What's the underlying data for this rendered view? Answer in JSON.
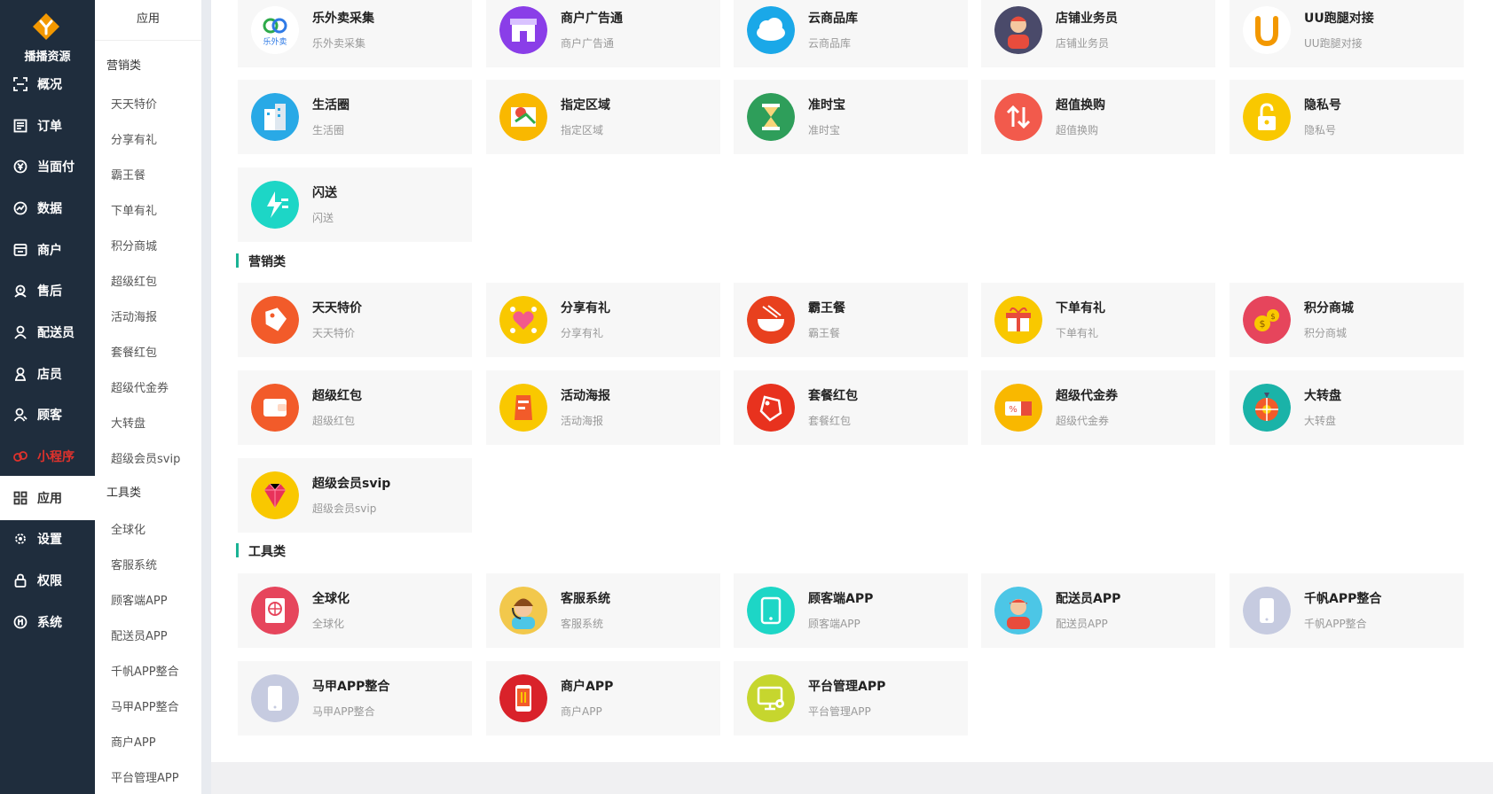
{
  "brand": {
    "name": "播播资源",
    "accent": "#f39800"
  },
  "sidebar": {
    "items": [
      {
        "label": "概况",
        "icon": "dashboard-icon"
      },
      {
        "label": "订单",
        "icon": "order-list-icon"
      },
      {
        "label": "当面付",
        "icon": "yuan-coin-icon"
      },
      {
        "label": "数据",
        "icon": "chart-icon"
      },
      {
        "label": "商户",
        "icon": "shop-icon"
      },
      {
        "label": "售后",
        "icon": "support-icon"
      },
      {
        "label": "配送员",
        "icon": "courier-icon"
      },
      {
        "label": "店员",
        "icon": "clerk-icon"
      },
      {
        "label": "顾客",
        "icon": "customer-icon"
      },
      {
        "label": "小程序",
        "icon": "mini-program-icon"
      },
      {
        "label": "应用",
        "icon": "apps-grid-icon"
      },
      {
        "label": "设置",
        "icon": "gear-icon"
      },
      {
        "label": "权限",
        "icon": "lock-icon"
      },
      {
        "label": "系统",
        "icon": "system-icon"
      }
    ]
  },
  "subnav": {
    "title": "应用",
    "marketing_heading": "营销类",
    "marketing_links": [
      "天天特价",
      "分享有礼",
      "霸王餐",
      "下单有礼",
      "积分商城",
      "超级红包",
      "活动海报",
      "套餐红包",
      "超级代金券",
      "大转盘",
      "超级会员svip"
    ],
    "tools_heading": "工具类",
    "tools_links": [
      "全球化",
      "客服系统",
      "顾客端APP",
      "配送员APP",
      "千帆APP整合",
      "马甲APP整合",
      "商户APP",
      "平台管理APP"
    ]
  },
  "sections": {
    "marketing": "营销类",
    "tools": "工具类"
  },
  "cards": {
    "top": [
      {
        "title": "乐外卖采集",
        "sub": "乐外卖采集",
        "icon": "lewaimai-logo-icon",
        "color": "#ffffff"
      },
      {
        "title": "商户广告通",
        "sub": "商户广告通",
        "icon": "storefront-icon",
        "color": "#8a3ee8"
      },
      {
        "title": "云商品库",
        "sub": "云商品库",
        "icon": "cloud-icon",
        "color": "#1aa8e8"
      },
      {
        "title": "店铺业务员",
        "sub": "店铺业务员",
        "icon": "salesman-icon",
        "color": "#4a4a6a"
      },
      {
        "title": "UU跑腿对接",
        "sub": "UU跑腿对接",
        "icon": "uu-logo-icon",
        "color": "#ffffff"
      },
      {
        "title": "生活圈",
        "sub": "生活圈",
        "icon": "buildings-icon",
        "color": "#29a9e6"
      },
      {
        "title": "指定区域",
        "sub": "指定区域",
        "icon": "map-pin-icon",
        "color": "#f9b800"
      },
      {
        "title": "准时宝",
        "sub": "准时宝",
        "icon": "hourglass-icon",
        "color": "#2e9e5a"
      },
      {
        "title": "超值换购",
        "sub": "超值换购",
        "icon": "exchange-arrows-icon",
        "color": "#f25a4c"
      },
      {
        "title": "隐私号",
        "sub": "隐私号",
        "icon": "padlock-icon",
        "color": "#f9c800"
      },
      {
        "title": "闪送",
        "sub": "闪送",
        "icon": "flash-delivery-icon",
        "color": "#1dd6c6"
      }
    ],
    "marketing": [
      {
        "title": "天天特价",
        "sub": "天天特价",
        "icon": "price-tag-icon",
        "color": "#f25b2a"
      },
      {
        "title": "分享有礼",
        "sub": "分享有礼",
        "icon": "share-heart-icon",
        "color": "#f9c800"
      },
      {
        "title": "霸王餐",
        "sub": "霸王餐",
        "icon": "noodle-bowl-icon",
        "color": "#e8401e"
      },
      {
        "title": "下单有礼",
        "sub": "下单有礼",
        "icon": "gift-box-icon",
        "color": "#f9c800"
      },
      {
        "title": "积分商城",
        "sub": "积分商城",
        "icon": "coins-icon",
        "color": "#e6455c"
      },
      {
        "title": "超级红包",
        "sub": "超级红包",
        "icon": "wallet-icon",
        "color": "#f25b2a"
      },
      {
        "title": "活动海报",
        "sub": "活动海报",
        "icon": "poster-icon",
        "color": "#f9c800"
      },
      {
        "title": "套餐红包",
        "sub": "套餐红包",
        "icon": "coupon-tag-icon",
        "color": "#e8321e"
      },
      {
        "title": "超级代金券",
        "sub": "超级代金券",
        "icon": "voucher-icon",
        "color": "#f9b800"
      },
      {
        "title": "大转盘",
        "sub": "大转盘",
        "icon": "wheel-icon",
        "color": "#1ab3a8"
      },
      {
        "title": "超级会员svip",
        "sub": "超级会员svip",
        "icon": "diamond-icon",
        "color": "#f9c800"
      }
    ],
    "tools": [
      {
        "title": "全球化",
        "sub": "全球化",
        "icon": "globe-book-icon",
        "color": "#e6455c"
      },
      {
        "title": "客服系统",
        "sub": "客服系统",
        "icon": "headset-agent-icon",
        "color": "#f2c84c"
      },
      {
        "title": "顾客端APP",
        "sub": "顾客端APP",
        "icon": "tablet-icon",
        "color": "#1dd6c6"
      },
      {
        "title": "配送员APP",
        "sub": "配送员APP",
        "icon": "courier-avatar-icon",
        "color": "#4cc6e6"
      },
      {
        "title": "千帆APP整合",
        "sub": "千帆APP整合",
        "icon": "phone-icon",
        "color": "#c6cbe0"
      },
      {
        "title": "马甲APP整合",
        "sub": "马甲APP整合",
        "icon": "phone-icon",
        "color": "#c6cbe0"
      },
      {
        "title": "商户APP",
        "sub": "商户APP",
        "icon": "mobile-menu-icon",
        "color": "#d9222a"
      },
      {
        "title": "平台管理APP",
        "sub": "平台管理APP",
        "icon": "monitor-gear-icon",
        "color": "#c6d62e"
      }
    ]
  }
}
